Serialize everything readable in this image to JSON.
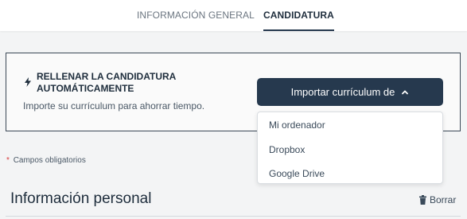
{
  "tabs": [
    {
      "label": "INFORMACIÓN GENERAL",
      "active": false
    },
    {
      "label": "CANDIDATURA",
      "active": true
    }
  ],
  "autofill": {
    "icon": "lightning-bolt-icon",
    "title_line1": "RELLENAR LA CANDIDATURA",
    "title_line2": "AUTOMÁTICAMENTE",
    "subtitle": "Importe su currículum para ahorrar tiempo.",
    "import_button_label": "Importar currículum de",
    "import_button_icon": "chevron-up-icon"
  },
  "dropdown": {
    "items": [
      "Mi ordenador",
      "Dropbox",
      "Google Drive"
    ]
  },
  "required_note": {
    "marker": "*",
    "text": "Campos obligatorios"
  },
  "personal_section": {
    "title": "Información personal",
    "delete_label": "Borrar",
    "delete_icon": "trash-icon"
  },
  "colors": {
    "primary": "#26394e",
    "required_star": "#d93b3b",
    "background": "#f3f4f5"
  }
}
